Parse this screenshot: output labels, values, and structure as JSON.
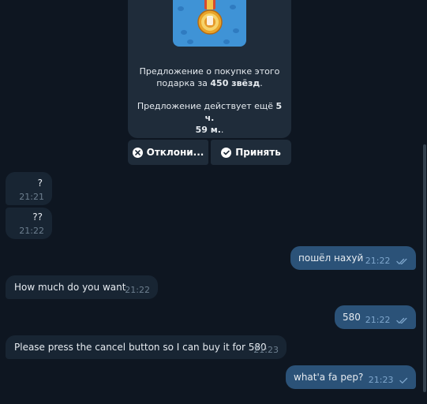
{
  "offer": {
    "line1": "Предложение о покупке этого",
    "line2_prefix": "подарка за ",
    "line2_bold": "450 звёзд",
    "line2_suffix": ".",
    "line3_prefix": "Предложение действует ещё ",
    "line3_bold": "5 ч.",
    "line4_bold": "59 м.",
    "line4_suffix": ".",
    "decline_label": "Отклони...",
    "accept_label": "Принять"
  },
  "messages": [
    {
      "direction": "in",
      "text": "?",
      "time": "21:21"
    },
    {
      "direction": "in",
      "text": "??",
      "time": "21:22"
    },
    {
      "direction": "out",
      "text": "пошёл нахуй",
      "time": "21:22",
      "status": "read"
    },
    {
      "direction": "in",
      "text": "How much do you want",
      "time": "21:22"
    },
    {
      "direction": "out",
      "text": "580",
      "time": "21:22",
      "status": "read"
    },
    {
      "direction": "in",
      "text": "Please press the cancel button so I can buy it for 580",
      "time": "21:23"
    },
    {
      "direction": "out",
      "text": "what'a fa pep?",
      "time": "21:23",
      "status": "sent"
    }
  ],
  "colors": {
    "background": "#0e1621",
    "incoming": "#182533",
    "outgoing": "#2b5278",
    "gift_background": "#3f93d6",
    "check": "#7ea6cc"
  }
}
